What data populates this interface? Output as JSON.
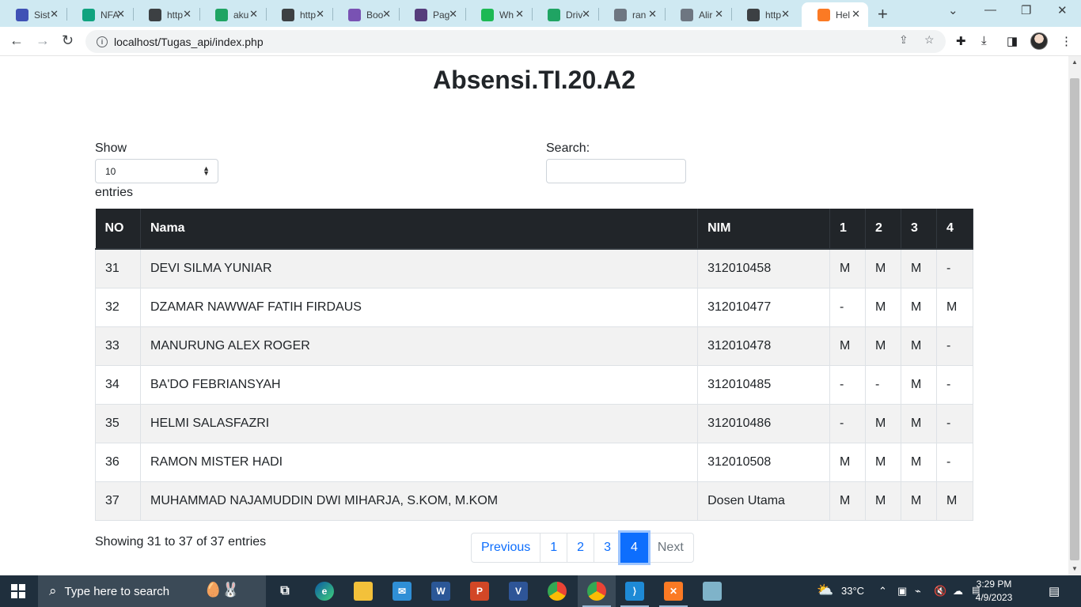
{
  "browser": {
    "tabs": [
      {
        "title": "Sist",
        "icon": "blue-swirl-icon",
        "color": "#3f51b5"
      },
      {
        "title": "NFA",
        "icon": "openai-icon",
        "color": "#10a37f"
      },
      {
        "title": "http",
        "icon": "globe-icon",
        "color": "#3c4043"
      },
      {
        "title": "aku",
        "icon": "google-drive-icon",
        "color": "#1fa463"
      },
      {
        "title": "http",
        "icon": "globe-icon",
        "color": "#3c4043"
      },
      {
        "title": "Boo",
        "icon": "bootstrap-icon",
        "color": "#7952b3"
      },
      {
        "title": "Pag",
        "icon": "bootstrap-icon",
        "color": "#563d7c"
      },
      {
        "title": "Wh",
        "icon": "green-badge-icon",
        "color": "#1db954"
      },
      {
        "title": "Driv",
        "icon": "google-drive-icon",
        "color": "#1fa463"
      },
      {
        "title": "ran",
        "icon": "github-icon",
        "color": "#6e7681"
      },
      {
        "title": "Alir",
        "icon": "github-icon",
        "color": "#6e7681"
      },
      {
        "title": "http",
        "icon": "globe-icon",
        "color": "#3c4043"
      },
      {
        "title": "Hel",
        "icon": "xampp-icon",
        "color": "#fb7a24"
      }
    ],
    "url": "localhost/Tugas_api/index.php"
  },
  "page": {
    "title": "Absensi.TI.20.A2",
    "length": {
      "show_label": "Show",
      "value": "10",
      "entries_label": "entries"
    },
    "search": {
      "label": "Search:",
      "value": ""
    },
    "table": {
      "headers": [
        "NO",
        "Nama",
        "NIM",
        "1",
        "2",
        "3",
        "4"
      ],
      "rows": [
        [
          "31",
          "DEVI SILMA YUNIAR",
          "312010458",
          "M",
          "M",
          "M",
          "-"
        ],
        [
          "32",
          "DZAMAR NAWWAF FATIH FIRDAUS",
          "312010477",
          "-",
          "M",
          "M",
          "M"
        ],
        [
          "33",
          "MANURUNG ALEX ROGER",
          "312010478",
          "M",
          "M",
          "M",
          "-"
        ],
        [
          "34",
          "BA'DO FEBRIANSYAH",
          "312010485",
          "-",
          "-",
          "M",
          "-"
        ],
        [
          "35",
          "HELMI SALASFAZRI",
          "312010486",
          "-",
          "M",
          "M",
          "-"
        ],
        [
          "36",
          "RAMON MISTER HADI",
          "312010508",
          "M",
          "M",
          "M",
          "-"
        ],
        [
          "37",
          "MUHAMMAD NAJAMUDDIN DWI MIHARJA, S.KOM, M.KOM",
          "Dosen Utama",
          "M",
          "M",
          "M",
          "M"
        ]
      ]
    },
    "info": "Showing 31 to 37 of 37 entries",
    "pagination": {
      "previous": "Previous",
      "pages": [
        "1",
        "2",
        "3",
        "4"
      ],
      "active_page": "4",
      "next": "Next"
    }
  },
  "taskbar": {
    "search_placeholder": "Type here to search",
    "weather": "33°C",
    "time": "3:29 PM",
    "date": "4/9/2023"
  }
}
